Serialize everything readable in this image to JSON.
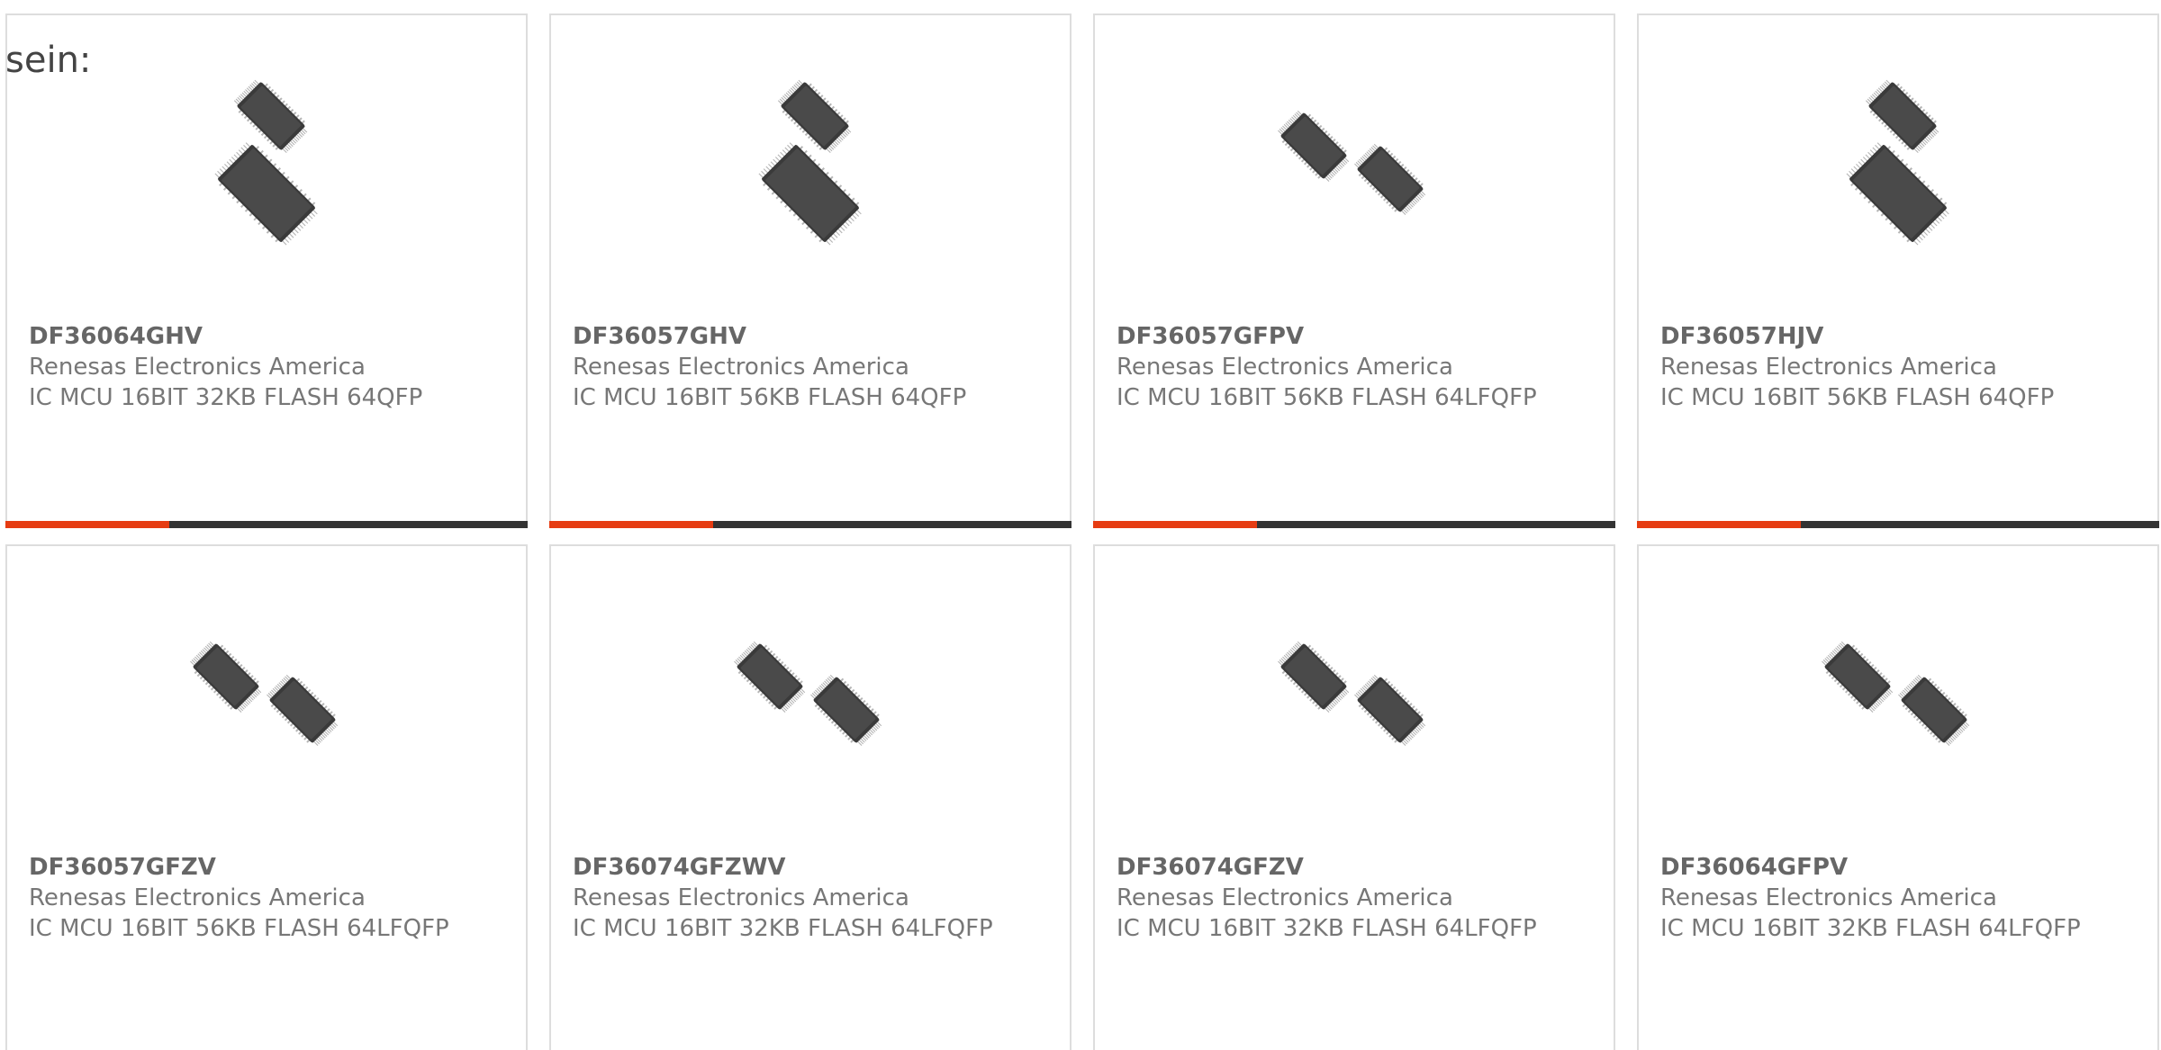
{
  "intro_text": "sein:",
  "colors": {
    "accent": "#e63c12",
    "bar_dark": "#333333",
    "border": "#dddddd",
    "text": "#666666"
  },
  "products": [
    {
      "part_number": "DF36064GHV",
      "manufacturer": "Renesas Electronics America",
      "description": "IC MCU 16BIT 32KB FLASH 64QFP",
      "image_icon": "qfp-chips-stacked-icon",
      "image_style": "stacked"
    },
    {
      "part_number": "DF36057GHV",
      "manufacturer": "Renesas Electronics America",
      "description": "IC MCU 16BIT 56KB FLASH 64QFP",
      "image_icon": "qfp-chips-stacked-icon",
      "image_style": "stacked"
    },
    {
      "part_number": "DF36057GFPV",
      "manufacturer": "Renesas Electronics America",
      "description": "IC MCU 16BIT 56KB FLASH 64LFQFP",
      "image_icon": "lqfp-chips-side-by-side-icon",
      "image_style": "side"
    },
    {
      "part_number": "DF36057HJV",
      "manufacturer": "Renesas Electronics America",
      "description": "IC MCU 16BIT 56KB FLASH 64QFP",
      "image_icon": "qfp-chips-stacked-icon",
      "image_style": "stacked"
    },
    {
      "part_number": "DF36057GFZV",
      "manufacturer": "Renesas Electronics America",
      "description": "IC MCU 16BIT 56KB FLASH 64LFQFP",
      "image_icon": "lqfp-chips-side-by-side-icon",
      "image_style": "side"
    },
    {
      "part_number": "DF36074GFZWV",
      "manufacturer": "Renesas Electronics America",
      "description": "IC MCU 16BIT 32KB FLASH 64LFQFP",
      "image_icon": "lqfp-chips-side-by-side-icon",
      "image_style": "side"
    },
    {
      "part_number": "DF36074GFZV",
      "manufacturer": "Renesas Electronics America",
      "description": "IC MCU 16BIT 32KB FLASH 64LFQFP",
      "image_icon": "lqfp-chips-side-by-side-icon",
      "image_style": "side"
    },
    {
      "part_number": "DF36064GFPV",
      "manufacturer": "Renesas Electronics America",
      "description": "IC MCU 16BIT 32KB FLASH 64LFQFP",
      "image_icon": "lqfp-chips-side-by-side-icon",
      "image_style": "side"
    }
  ]
}
